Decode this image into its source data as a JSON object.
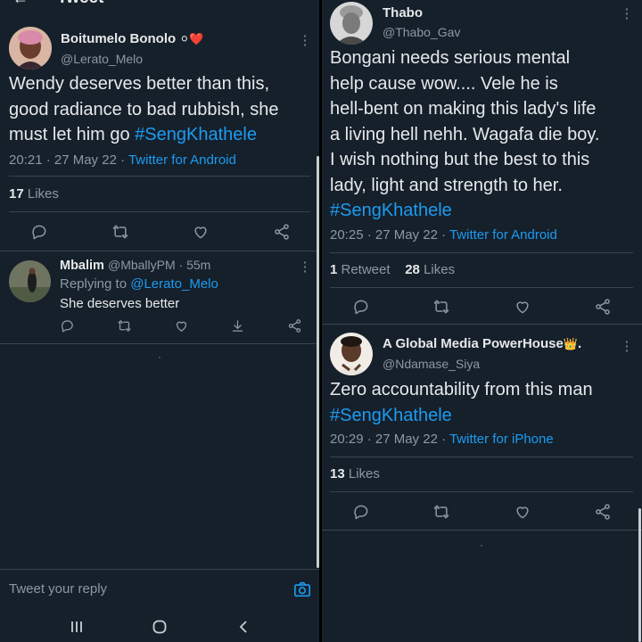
{
  "left": {
    "header_partial": "Tweet",
    "main_tweet": {
      "author_name": "Boitumelo Bonolo",
      "author_emojis": "⚪❤️",
      "author_handle": "@Lerato_Melo",
      "text_lines": [
        "Wendy deserves better than this,",
        "good radiance to bad rubbish, she",
        "must let him go "
      ],
      "hashtag": "#SengKhathele",
      "timestamp": "20:21 · 27 May 22 · ",
      "source": "Twitter for Android",
      "likes_count": "17",
      "likes_label": " Likes"
    },
    "reply": {
      "author_name": "Mbalim",
      "author_handle": "@MballyPM",
      "time": " · 55m",
      "replying_prefix": "Replying to ",
      "replying_to": "@Lerato_Melo",
      "text": "She deserves better"
    },
    "composer": {
      "placeholder": "Tweet your reply"
    }
  },
  "right": {
    "tweet1": {
      "author_name": "Thabo",
      "author_handle": "@Thabo_Gav",
      "text_lines": [
        "Bongani needs serious mental",
        "help cause wow.... Vele he is",
        "hell-bent on making this lady's life",
        "a living hell nehh. Wagafa die boy.",
        "I wish nothing but the best to this",
        "lady, light and strength to her."
      ],
      "hashtag": "#SengKhathele",
      "timestamp": "20:25 · 27 May 22 · ",
      "source": "Twitter for Android",
      "retweets_count": "1",
      "retweets_label": " Retweet",
      "likes_count": "28",
      "likes_label": " Likes"
    },
    "tweet2": {
      "author_name": "A Global Media PowerHouse",
      "author_emoji": "👑",
      "author_suffix": ".",
      "author_handle": "@Ndamase_Siya",
      "text_line": "Zero accountability from this man",
      "hashtag": "#SengKhathele",
      "timestamp": "20:29 · 27 May 22 · ",
      "source": "Twitter for iPhone",
      "likes_count": "13",
      "likes_label": " Likes"
    }
  },
  "colors": {
    "background": "#15202b",
    "accent": "#1d9bf0",
    "secondary_text": "#8b98a5",
    "primary_text": "#e6e9ea",
    "divider": "#38444d"
  }
}
